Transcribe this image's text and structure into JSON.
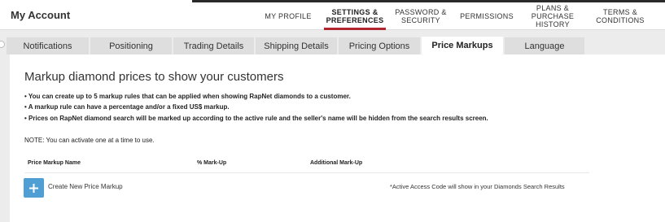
{
  "header": {
    "brand": "My Account",
    "nav": [
      {
        "label": "MY PROFILE"
      },
      {
        "label": "SETTINGS &\nPREFERENCES",
        "active": true
      },
      {
        "label": "PASSWORD &\nSECURITY"
      },
      {
        "label": "PERMISSIONS"
      },
      {
        "label": "PLANS &\nPURCHASE\nHISTORY"
      },
      {
        "label": "TERMS &\nCONDITIONS"
      }
    ],
    "active_color": "#b0252e"
  },
  "subtabs": [
    {
      "label": "Notifications"
    },
    {
      "label": "Positioning"
    },
    {
      "label": "Trading Details"
    },
    {
      "label": "Shipping Details"
    },
    {
      "label": "Pricing Options"
    },
    {
      "label": "Price Markups",
      "active": true
    },
    {
      "label": "Language"
    }
  ],
  "content": {
    "heading": "Markup diamond prices to show your customers",
    "bullets": [
      "• You can create up to 5 markup rules that can be applied when showing RapNet diamonds to a customer.",
      "• A markup rule can have a percentage and/or a fixed US$ markup.",
      "• Prices on RapNet diamond search will be marked up according to the active rule and the seller's name will be hidden from the search results screen."
    ],
    "note": "NOTE: You can activate one at a time to use.",
    "table_headers": [
      "Price Markup Name",
      "% Mark-Up",
      "Additional Mark-Up"
    ],
    "create_label": "Create New Price Markup",
    "footnote": "*Active Access Code will show in your Diamonds Search Results",
    "add_button_color": "#4f9fd5",
    "add_icon": "plus-icon"
  }
}
